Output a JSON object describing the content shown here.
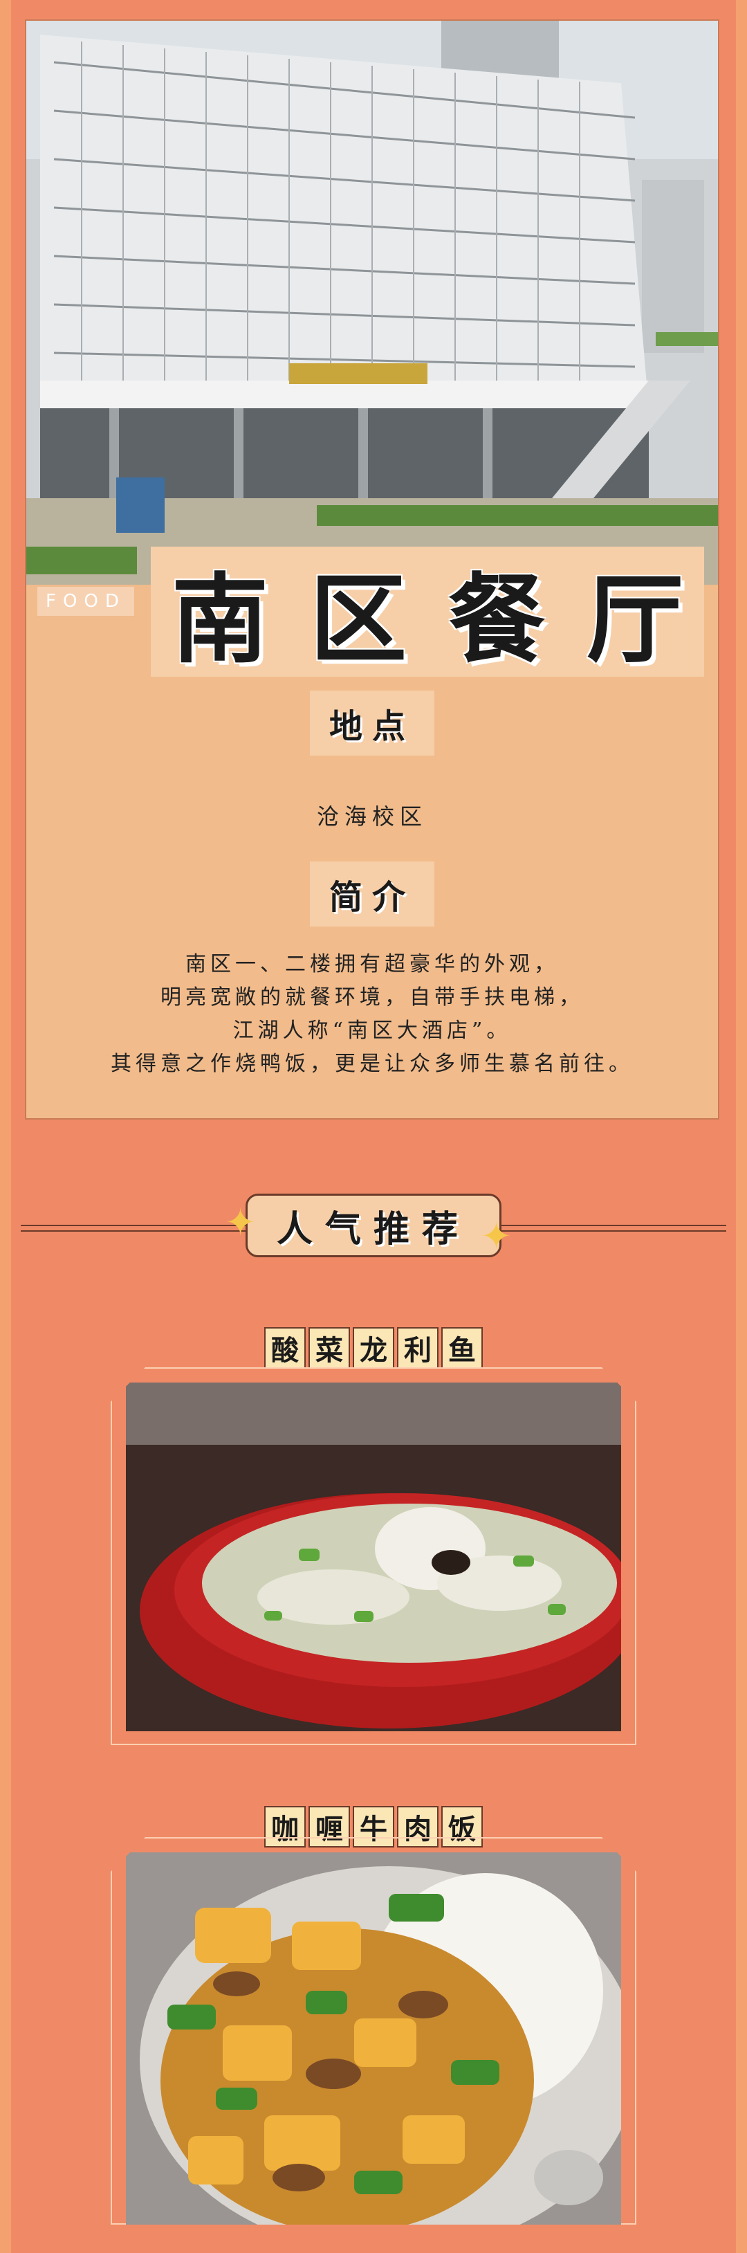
{
  "hero": {
    "food_tag": "FOOD",
    "title": "南区餐厅"
  },
  "location": {
    "label": "地点",
    "value": "沧海校区"
  },
  "intro": {
    "label": "简介",
    "lines": [
      "南区一、二楼拥有超豪华的外观，",
      "明亮宽敞的就餐环境，自带手扶电梯，",
      "江湖人称“南区大酒店”。",
      "其得意之作烧鸭饭，更是让众多师生慕名前往。"
    ]
  },
  "recommend": {
    "section_title": "人气推荐",
    "dishes": [
      {
        "name": "酸菜龙利鱼",
        "chars": [
          "酸",
          "菜",
          "龙",
          "利",
          "鱼"
        ]
      },
      {
        "name": "咖喱牛肉饭",
        "chars": [
          "咖",
          "喱",
          "牛",
          "肉",
          "饭"
        ]
      }
    ]
  },
  "colors": {
    "background": "#f08a66",
    "card": "#f1bb8b",
    "label_box": "#f6cfa8",
    "accent_dark": "#6b3a29"
  }
}
